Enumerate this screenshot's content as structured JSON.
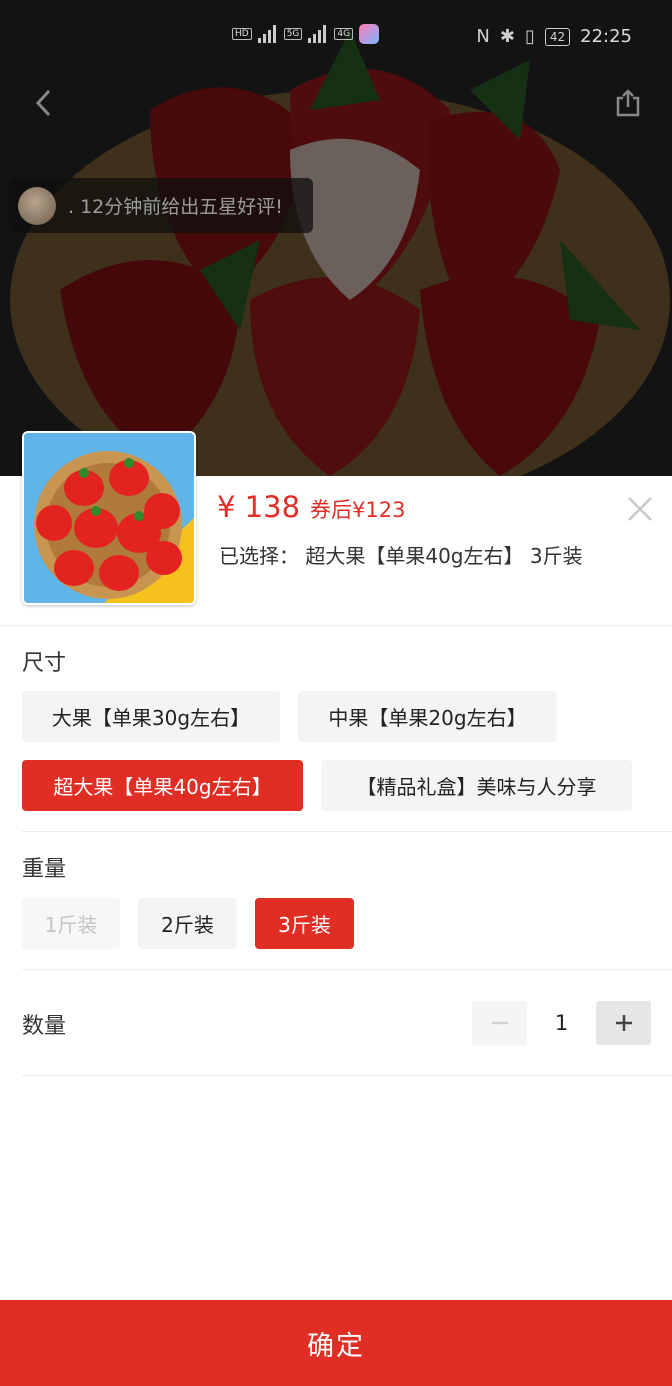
{
  "status_bar": {
    "left_indicators": [
      "HD",
      "5G",
      "4G"
    ],
    "time": "22:25",
    "battery": "42"
  },
  "toast": {
    "text": ". 12分钟前给出五星好评!"
  },
  "product": {
    "price": "¥ 138",
    "coupon_price": "券后¥123",
    "selected_label": "已选择：",
    "selected_value": "超大果【单果40g左右】 3斤装"
  },
  "size": {
    "title": "尺寸",
    "options": [
      {
        "label": "大果【单果30g左右】",
        "state": "normal"
      },
      {
        "label": "中果【单果20g左右】",
        "state": "normal"
      },
      {
        "label": "超大果【单果40g左右】",
        "state": "active"
      },
      {
        "label": "【精品礼盒】美味与人分享",
        "state": "normal"
      }
    ]
  },
  "weight": {
    "title": "重量",
    "options": [
      {
        "label": "1斤装",
        "state": "disabled"
      },
      {
        "label": "2斤装",
        "state": "normal"
      },
      {
        "label": "3斤装",
        "state": "active"
      }
    ]
  },
  "quantity": {
    "title": "数量",
    "value": "1"
  },
  "confirm_label": "确定",
  "colors": {
    "accent": "#e02e24",
    "chip_bg": "#f4f4f4",
    "text": "#222222"
  },
  "icons": [
    "back-icon",
    "share-icon",
    "close-icon",
    "minus-icon",
    "plus-icon"
  ]
}
